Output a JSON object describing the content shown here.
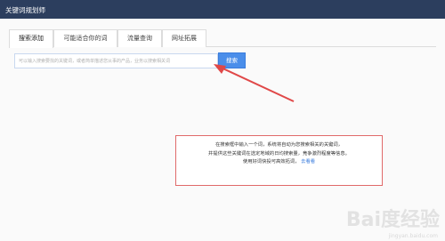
{
  "window": {
    "title": "关键词规划师"
  },
  "tabs": [
    {
      "label": "搜索添加",
      "active": true
    },
    {
      "label": "可能适合你的词",
      "active": false
    },
    {
      "label": "流量查询",
      "active": false
    },
    {
      "label": "网址拓展",
      "active": false
    }
  ],
  "search": {
    "placeholder": "可以输入搜索要找的关键词，或者简单描述您从事的产品，业务以搜索相关词",
    "button_label": "搜索"
  },
  "tip": {
    "line1": "在搜索框中输入一个词，系统将自动为您搜索相关的关键词，",
    "line2": "并提供这些关键词在选定地域的日均搜索量，竞争激烈程度等信息。",
    "line3": "使用好词快投可高效拓词，",
    "link": "去看看"
  },
  "watermark": {
    "text": "Bai度经验",
    "sub": "jingyan.baidu.com"
  },
  "colors": {
    "titlebar": "#2c3e5e",
    "button": "#4a8eea",
    "arrow": "#e04848",
    "tip_border": "#e06a6a"
  }
}
